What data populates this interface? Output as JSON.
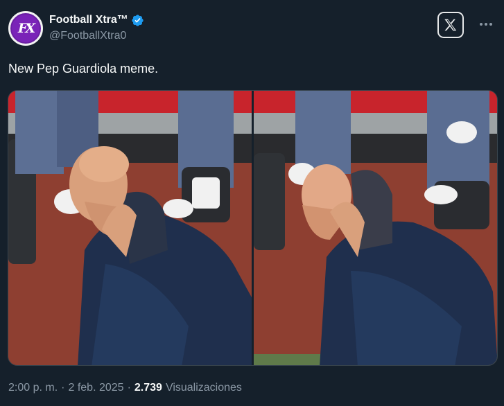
{
  "account": {
    "display_name": "Football Xtra™",
    "handle": "@FootballXtra0",
    "avatar_initials": "FX",
    "verified": true
  },
  "tweet": {
    "text": "New Pep Guardiola meme."
  },
  "media": {
    "count": 2,
    "panels": [
      "hand-on-cheek",
      "hands-on-head"
    ]
  },
  "meta": {
    "time": "2:00 p. m.",
    "separator": "·",
    "date": "2 feb. 2025",
    "views_count": "2.739",
    "views_label": "Visualizaciones"
  },
  "icons": {
    "verified": "verified-badge-icon",
    "x_logo": "x-logo-icon",
    "more": "more-options-icon"
  },
  "colors": {
    "background": "#15202b",
    "text_primary": "#f7f9f9",
    "text_secondary": "#8b98a5",
    "verified_blue": "#1d9bf0",
    "avatar_purple": "#6b1fa3"
  }
}
